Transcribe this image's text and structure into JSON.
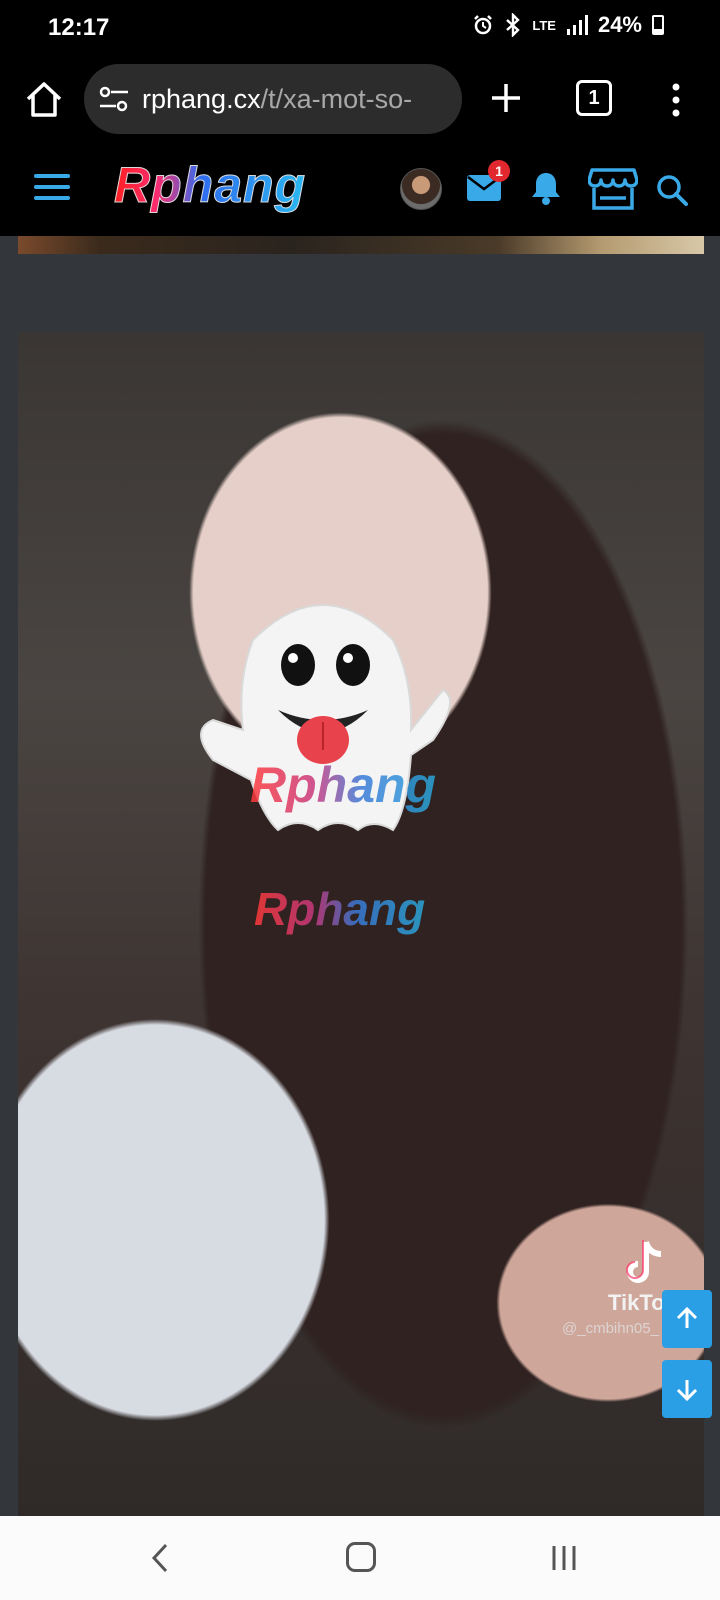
{
  "status_bar": {
    "time": "12:17",
    "network": "LTE",
    "battery": "24%"
  },
  "browser": {
    "url_domain": "rphang.cx",
    "url_path": "/t/xa-mot-so-",
    "tab_count": "1"
  },
  "site_header": {
    "logo": "Rphang",
    "mail_badge": "1"
  },
  "content": {
    "watermark_primary": "Rphang",
    "watermark_secondary": "Rphang",
    "tiktok_label": "TikTok",
    "tiktok_user": "@_cmbihn05_"
  },
  "colors": {
    "accent": "#2b9fe6",
    "badge": "#e0282e",
    "content_bg": "#33373c"
  }
}
